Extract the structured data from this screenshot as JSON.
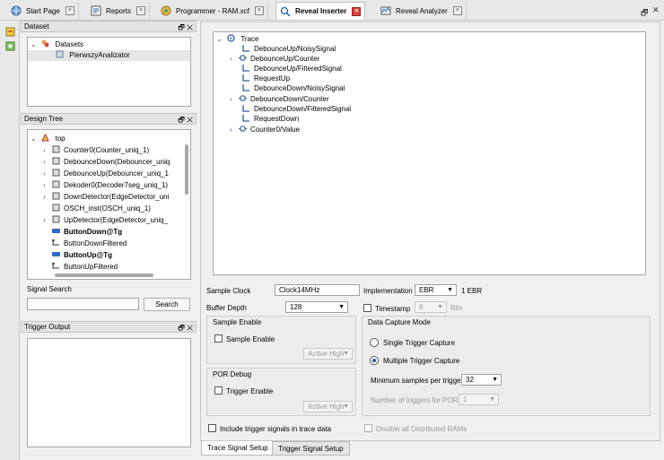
{
  "tabs": [
    {
      "label": "Start Page"
    },
    {
      "label": "Reports"
    },
    {
      "label": "Programmer - RAM.xcf"
    },
    {
      "label": "Reveal Inserter"
    },
    {
      "label": "Reveal Analyzer"
    }
  ],
  "dataset": {
    "title": "Dataset",
    "items": [
      "Datasets",
      "PierwszyAnalizator"
    ]
  },
  "design_tree": {
    "title": "Design Tree",
    "items": [
      "top",
      "Counter0(Counter_uniq_1)",
      "DebounceDown(Debouncer_uniq",
      "DebounceUp(Debouncer_uniq_1",
      "Dekoder0(Decoder7seg_uniq_1)",
      "DownDetector(EdgeDetector_uni",
      "OSCH_inst(OSCH_uniq_1)",
      "UpDetector(EdgeDetector_uniq_",
      "ButtonDown@Tg",
      "ButtonDownFiltered",
      "ButtonUp@Tg",
      "ButtonUpFiltered"
    ]
  },
  "signal_search": {
    "label": "Signal Search",
    "value": "",
    "button": "Search"
  },
  "trigger_output": {
    "title": "Trigger Output"
  },
  "trace": {
    "root": "Trace",
    "items": [
      "DebounceUp/NoisySignal",
      "DebounceUp/Counter",
      "DebounceUp/FilteredSignal",
      "RequestUp",
      "DebounceDown/NoisySignal",
      "DebounceDown/Counter",
      "DebounceDown/FilteredSignal",
      "RequestDown",
      "Counter0/Value"
    ]
  },
  "settings": {
    "sample_clock_label": "Sample Clock",
    "sample_clock_value": "Clock14MHz",
    "buffer_depth_label": "Buffer Depth",
    "buffer_depth_value": "128",
    "implementation_label": "Implementation",
    "implementation_value": "EBR",
    "implementation_note": "1 EBR",
    "timestamp_label": "Timestamp",
    "timestamp_value": "8",
    "timestamp_unit": "Bits",
    "sample_enable_group": "Sample Enable",
    "sample_enable_cb": "Sample Enable",
    "active_high_1": "Active High",
    "por_debug_group": "POR Debug",
    "trigger_enable_cb": "Trigger Enable",
    "active_high_2": "Active High",
    "data_capture_group": "Data Capture Mode",
    "single_trigger": "Single Trigger Capture",
    "multiple_trigger": "Multiple Trigger Capture",
    "min_samples_label": "Minimum samples per trigger",
    "min_samples_value": "32",
    "num_triggers_label": "Number of triggers for POR",
    "num_triggers_value": "1",
    "include_trigger": "Include trigger signals in trace data",
    "disable_rams": "Disable all Distributed RAMs"
  },
  "bottom_tabs": [
    "Trace Signal Setup",
    "Trigger Signal Setup"
  ]
}
